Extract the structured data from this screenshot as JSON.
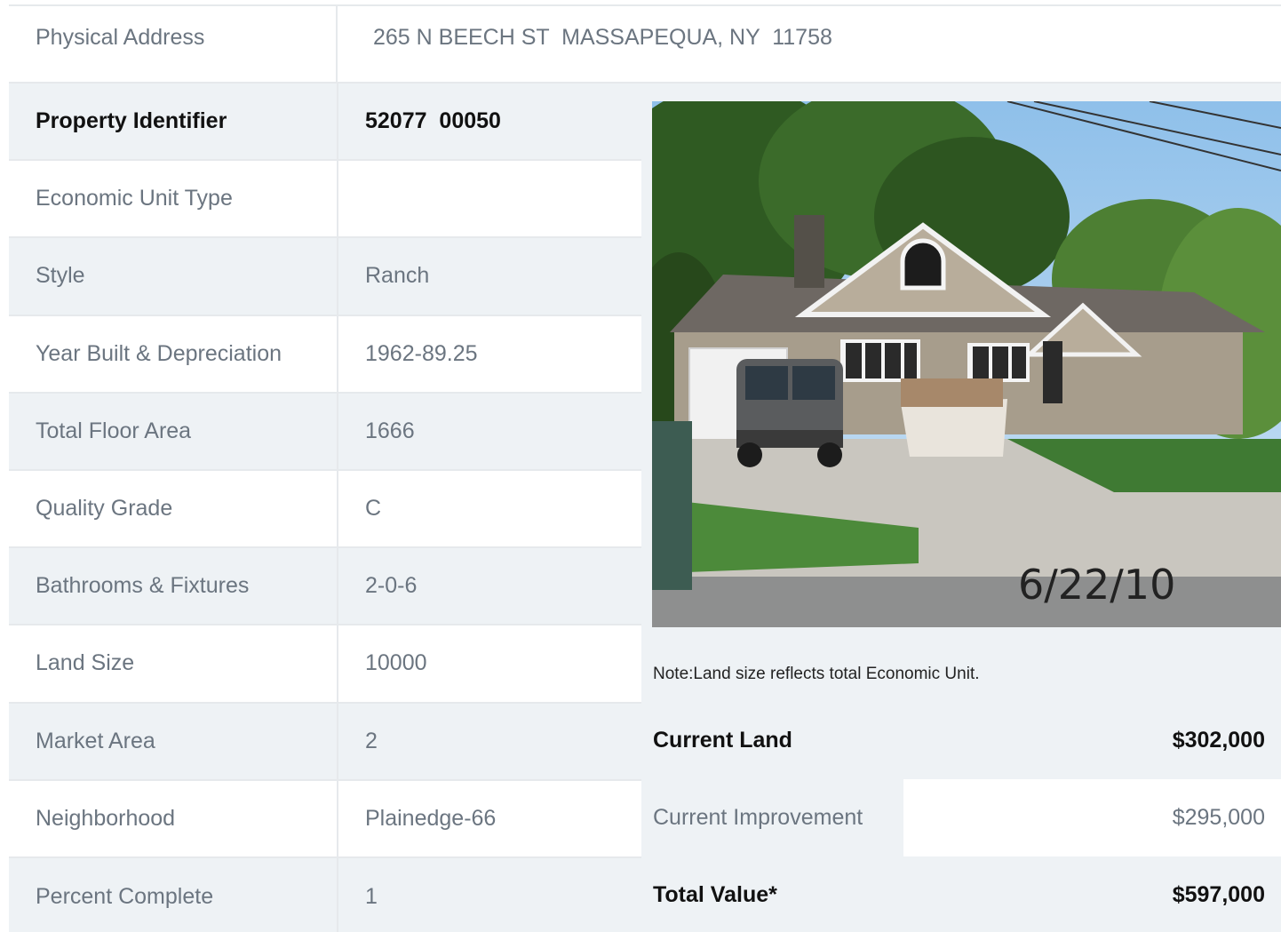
{
  "address": {
    "label": "Physical Address",
    "value": "265 N BEECH ST  MASSAPEQUA, NY  11758"
  },
  "property_rows": [
    {
      "label": "Property Identifier",
      "value": "52077  00050"
    },
    {
      "label": "Economic Unit Type",
      "value": ""
    },
    {
      "label": "Style",
      "value": "Ranch"
    },
    {
      "label": "Year Built & Depreciation",
      "value": "1962-89.25"
    },
    {
      "label": "Total Floor Area",
      "value": "1666"
    },
    {
      "label": "Quality Grade",
      "value": "C"
    },
    {
      "label": "Bathrooms & Fixtures",
      "value": "2-0-6"
    },
    {
      "label": "Land Size",
      "value": "10000"
    },
    {
      "label": "Market Area",
      "value": "2"
    },
    {
      "label": "Neighborhood",
      "value": "Plainedge-66"
    },
    {
      "label": "Percent Complete",
      "value": "1"
    }
  ],
  "photo": {
    "date_stamp": "6/22/10"
  },
  "note": "Note:Land size reflects total Economic Unit.",
  "valuation": [
    {
      "label": "Current Land",
      "value": "$302,000"
    },
    {
      "label": "Current Improvement",
      "value": "$295,000"
    },
    {
      "label": "Total Value*",
      "value": "$597,000"
    }
  ]
}
